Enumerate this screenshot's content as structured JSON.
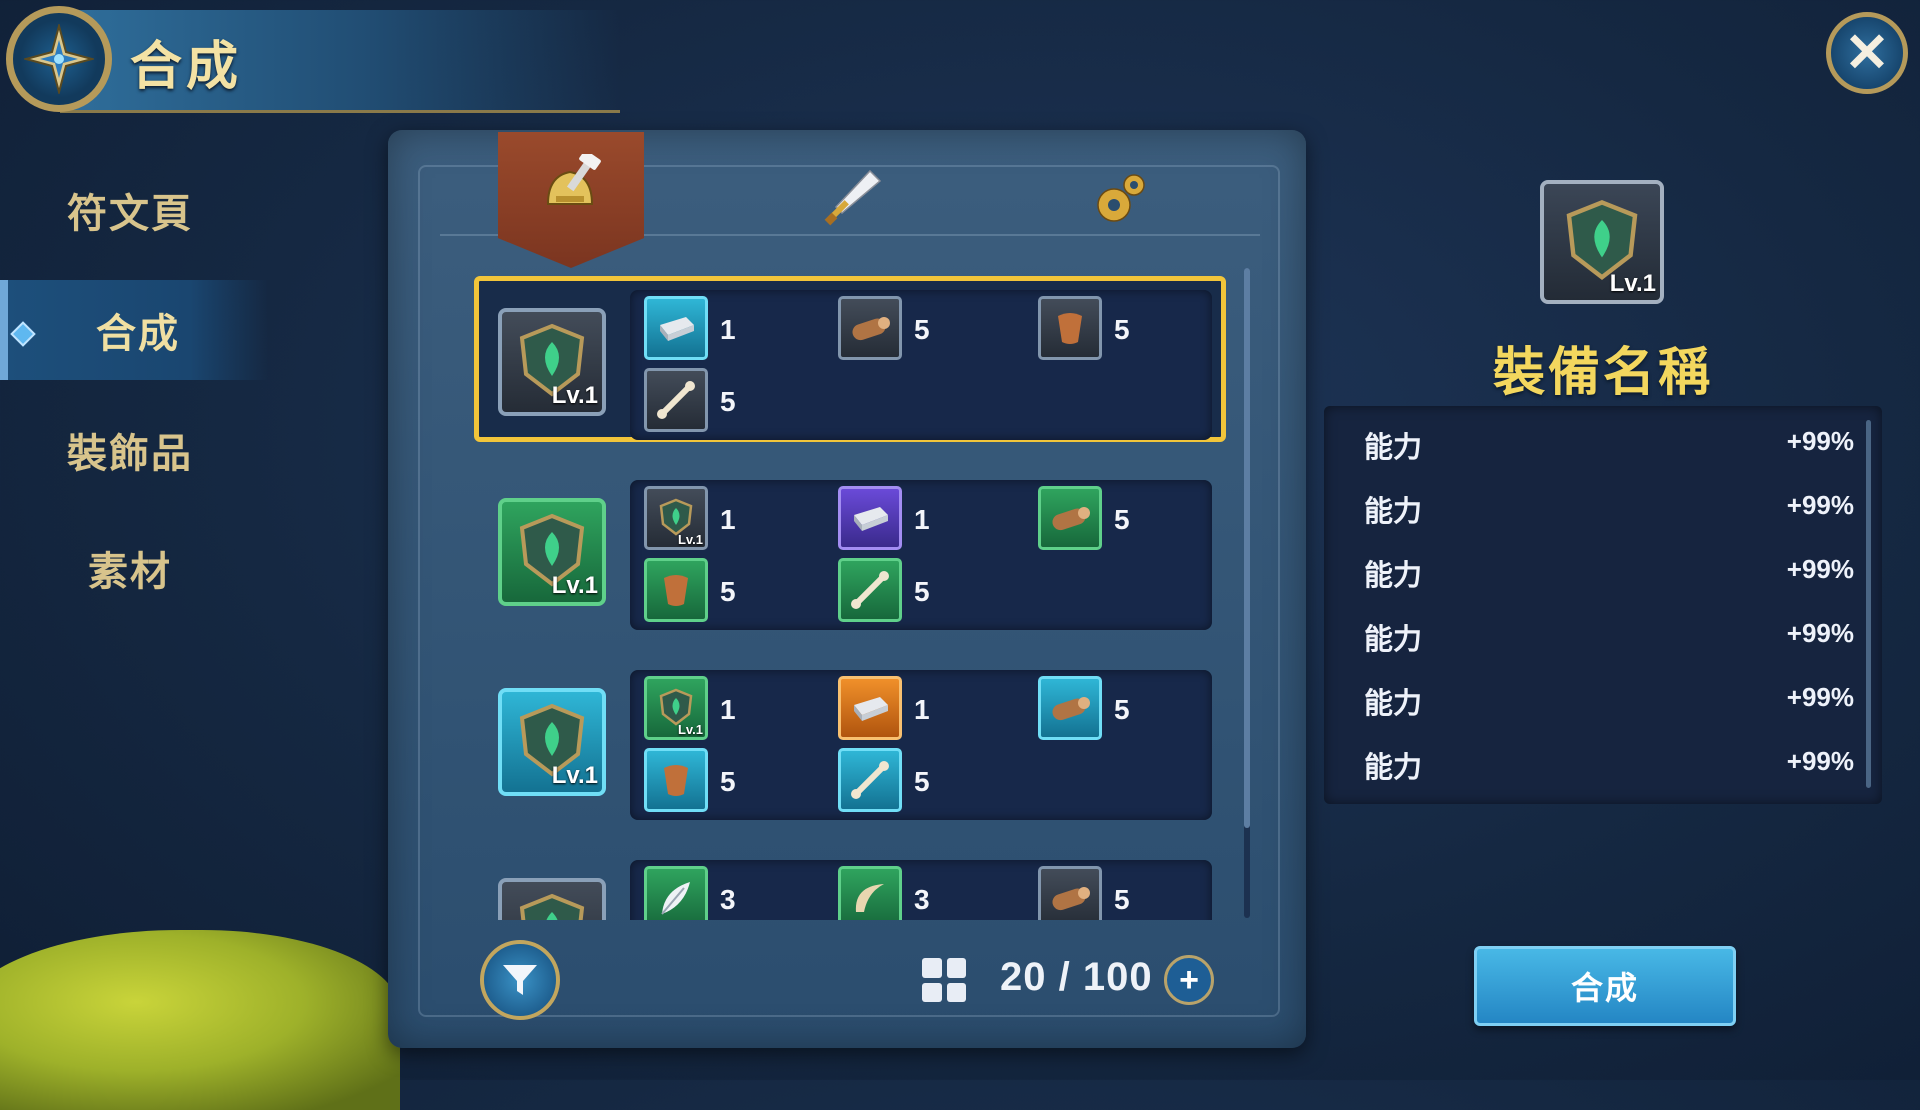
{
  "header": {
    "title": "合成"
  },
  "nav": {
    "items": [
      {
        "label": "符文頁",
        "active": false
      },
      {
        "label": "合成",
        "active": true
      },
      {
        "label": "裝飾品",
        "active": false
      },
      {
        "label": "素材",
        "active": false
      }
    ]
  },
  "tabs": [
    {
      "icon": "helmet-hammer-icon",
      "active": true
    },
    {
      "icon": "sword-icon",
      "active": false
    },
    {
      "icon": "gear-icon",
      "active": false
    }
  ],
  "recipes": [
    {
      "rarity": "dark",
      "level": "Lv.1",
      "selected": true,
      "ingredients": [
        {
          "icon": "iron-ingot-icon",
          "rarity": "cyan",
          "qty": "1"
        },
        {
          "icon": "wood-log-icon",
          "rarity": "dark",
          "qty": "5"
        },
        {
          "icon": "leather-icon",
          "rarity": "dark",
          "qty": "5"
        },
        {
          "icon": "bone-icon",
          "rarity": "dark",
          "qty": "5"
        }
      ]
    },
    {
      "rarity": "green",
      "level": "Lv.1",
      "selected": false,
      "ingredients": [
        {
          "icon": "rune-shield-icon",
          "rarity": "dark",
          "qty": "1",
          "level": "Lv.1"
        },
        {
          "icon": "iron-ingot-icon",
          "rarity": "purple",
          "qty": "1"
        },
        {
          "icon": "wood-log-icon",
          "rarity": "green",
          "qty": "5"
        },
        {
          "icon": "leather-icon",
          "rarity": "green",
          "qty": "5"
        },
        {
          "icon": "bone-icon",
          "rarity": "green",
          "qty": "5"
        }
      ]
    },
    {
      "rarity": "cyan",
      "level": "Lv.1",
      "selected": false,
      "ingredients": [
        {
          "icon": "rune-shield-icon",
          "rarity": "green",
          "qty": "1",
          "level": "Lv.1"
        },
        {
          "icon": "iron-ingot-icon",
          "rarity": "orange",
          "qty": "1"
        },
        {
          "icon": "wood-log-icon",
          "rarity": "cyan",
          "qty": "5"
        },
        {
          "icon": "leather-icon",
          "rarity": "cyan",
          "qty": "5"
        },
        {
          "icon": "bone-icon",
          "rarity": "cyan",
          "qty": "5"
        }
      ]
    },
    {
      "rarity": "dark",
      "level": "",
      "selected": false,
      "ingredients": [
        {
          "icon": "feather-icon",
          "rarity": "green",
          "qty": "3"
        },
        {
          "icon": "horn-icon",
          "rarity": "green",
          "qty": "3"
        },
        {
          "icon": "wood-log-icon",
          "rarity": "dark",
          "qty": "5"
        }
      ]
    }
  ],
  "inventory": {
    "capacity": "20 / 100"
  },
  "detail": {
    "level": "Lv.1",
    "name": "裝備名稱",
    "stats": [
      {
        "label": "能力",
        "value": "+99%"
      },
      {
        "label": "能力",
        "value": "+99%"
      },
      {
        "label": "能力",
        "value": "+99%"
      },
      {
        "label": "能力",
        "value": "+99%"
      },
      {
        "label": "能力",
        "value": "+99%"
      },
      {
        "label": "能力",
        "value": "+99%"
      }
    ],
    "craft_label": "合成"
  }
}
